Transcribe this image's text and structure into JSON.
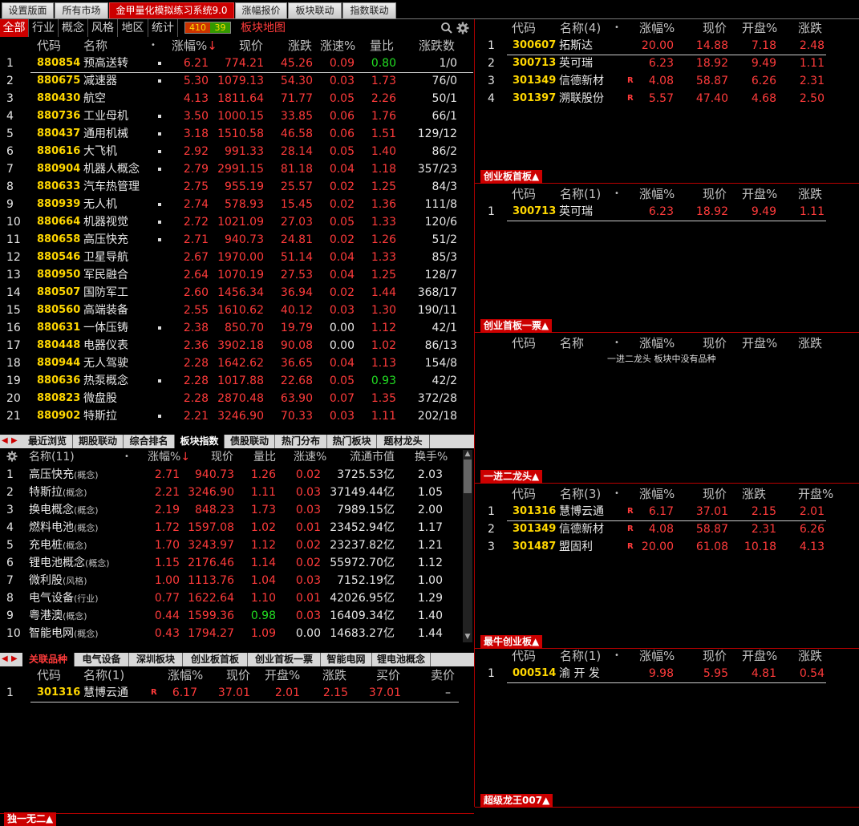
{
  "top_tabs": [
    "设置版面",
    "所有市场",
    "金甲量化模拟练习系统9.0",
    "涨幅报价",
    "板块联动",
    "指数联动"
  ],
  "cat_tabs": [
    "全部",
    "行业",
    "概念",
    "风格",
    "地区",
    "统计"
  ],
  "stat_counts": {
    "up": "410",
    "down": "39"
  },
  "map_link": "板块地图",
  "main_table": {
    "headers": [
      "代码",
      "名称",
      "涨幅%",
      "现价",
      "涨跌",
      "涨速%",
      "量比",
      "涨跌数"
    ],
    "rows": [
      [
        "1",
        "880854",
        "预高送转",
        "6.21",
        "774.21",
        "45.26",
        "0.09",
        "0.80",
        "1/0"
      ],
      [
        "2",
        "880675",
        "减速器",
        "5.30",
        "1079.13",
        "54.30",
        "0.03",
        "1.73",
        "76/0"
      ],
      [
        "3",
        "880430",
        "航空",
        "4.13",
        "1811.64",
        "71.77",
        "0.05",
        "2.26",
        "50/1"
      ],
      [
        "4",
        "880736",
        "工业母机",
        "3.50",
        "1000.15",
        "33.85",
        "0.06",
        "1.76",
        "66/1"
      ],
      [
        "5",
        "880437",
        "通用机械",
        "3.18",
        "1510.58",
        "46.58",
        "0.06",
        "1.51",
        "129/12"
      ],
      [
        "6",
        "880616",
        "大飞机",
        "2.92",
        "991.33",
        "28.14",
        "0.05",
        "1.40",
        "86/2"
      ],
      [
        "7",
        "880904",
        "机器人概念",
        "2.79",
        "2991.15",
        "81.18",
        "0.04",
        "1.18",
        "357/23"
      ],
      [
        "8",
        "880633",
        "汽车热管理",
        "2.75",
        "955.19",
        "25.57",
        "0.02",
        "1.25",
        "84/3"
      ],
      [
        "9",
        "880939",
        "无人机",
        "2.74",
        "578.93",
        "15.45",
        "0.02",
        "1.36",
        "111/8"
      ],
      [
        "10",
        "880664",
        "机器视觉",
        "2.72",
        "1021.09",
        "27.03",
        "0.05",
        "1.33",
        "120/6"
      ],
      [
        "11",
        "880658",
        "高压快充",
        "2.71",
        "940.73",
        "24.81",
        "0.02",
        "1.26",
        "51/2"
      ],
      [
        "12",
        "880546",
        "卫星导航",
        "2.67",
        "1970.00",
        "51.14",
        "0.04",
        "1.33",
        "85/3"
      ],
      [
        "13",
        "880950",
        "军民融合",
        "2.64",
        "1070.19",
        "27.53",
        "0.04",
        "1.25",
        "128/7"
      ],
      [
        "14",
        "880507",
        "国防军工",
        "2.60",
        "1456.34",
        "36.94",
        "0.02",
        "1.44",
        "368/17"
      ],
      [
        "15",
        "880560",
        "高端装备",
        "2.55",
        "1610.62",
        "40.12",
        "0.03",
        "1.30",
        "190/11"
      ],
      [
        "16",
        "880631",
        "一体压铸",
        "2.38",
        "850.70",
        "19.79",
        "0.00",
        "1.12",
        "42/1"
      ],
      [
        "17",
        "880448",
        "电器仪表",
        "2.36",
        "3902.18",
        "90.08",
        "0.00",
        "1.02",
        "86/13"
      ],
      [
        "18",
        "880944",
        "无人驾驶",
        "2.28",
        "1642.62",
        "36.65",
        "0.04",
        "1.13",
        "154/8"
      ],
      [
        "19",
        "880636",
        "热泵概念",
        "2.28",
        "1017.88",
        "22.68",
        "0.05",
        "0.93",
        "42/2"
      ],
      [
        "20",
        "880823",
        "微盘股",
        "2.28",
        "2870.48",
        "63.90",
        "0.07",
        "1.35",
        "372/28"
      ],
      [
        "21",
        "880902",
        "特斯拉",
        "2.21",
        "3246.90",
        "70.33",
        "0.03",
        "1.11",
        "202/18"
      ]
    ]
  },
  "mid_tabs": [
    "最近浏览",
    "期股联动",
    "综合排名",
    "板块指数",
    "债股联动",
    "热门分布",
    "热门板块",
    "题材龙头"
  ],
  "mid_table": {
    "headers": [
      "名称(11)",
      "涨幅%",
      "现价",
      "量比",
      "涨速%",
      "流通市值",
      "换手%"
    ],
    "rows": [
      [
        "1",
        "高压快充",
        "(概念)",
        "2.71",
        "940.73",
        "1.26",
        "0.02",
        "3725.53亿",
        "2.03"
      ],
      [
        "2",
        "特斯拉",
        "(概念)",
        "2.21",
        "3246.90",
        "1.11",
        "0.03",
        "37149.44亿",
        "1.05"
      ],
      [
        "3",
        "换电概念",
        "(概念)",
        "2.19",
        "848.23",
        "1.73",
        "0.03",
        "7989.15亿",
        "2.00"
      ],
      [
        "4",
        "燃料电池",
        "(概念)",
        "1.72",
        "1597.08",
        "1.02",
        "0.01",
        "23452.94亿",
        "1.17"
      ],
      [
        "5",
        "充电桩",
        "(概念)",
        "1.70",
        "3243.97",
        "1.12",
        "0.02",
        "23237.82亿",
        "1.21"
      ],
      [
        "6",
        "锂电池概念",
        "(概念)",
        "1.15",
        "2176.46",
        "1.14",
        "0.02",
        "55972.70亿",
        "1.12"
      ],
      [
        "7",
        "微利股",
        "(风格)",
        "1.00",
        "1113.76",
        "1.04",
        "0.03",
        "7152.19亿",
        "1.00"
      ],
      [
        "8",
        "电气设备",
        "(行业)",
        "0.77",
        "1622.64",
        "1.10",
        "0.01",
        "42026.95亿",
        "1.29"
      ],
      [
        "9",
        "粤港澳",
        "(概念)",
        "0.44",
        "1599.36",
        "0.98",
        "0.03",
        "16409.34亿",
        "1.40"
      ],
      [
        "10",
        "智能电网",
        "(概念)",
        "0.43",
        "1794.27",
        "1.09",
        "0.00",
        "14683.27亿",
        "1.44"
      ]
    ]
  },
  "bottom_tabs": [
    "关联品种",
    "电气设备",
    "深圳板块",
    "创业板首板",
    "创业首板一票",
    "智能电网",
    "锂电池概念"
  ],
  "bottom_table": {
    "headers": [
      "代码",
      "名称(1)",
      "涨幅%",
      "现价",
      "开盘%",
      "涨跌",
      "买价",
      "卖价"
    ],
    "rows": [
      [
        "1",
        "301316",
        "慧博云通",
        "R",
        "6.17",
        "37.01",
        "2.01",
        "2.15",
        "37.01",
        "–"
      ]
    ]
  },
  "left_footer": "独一无二",
  "panels": [
    {
      "headers": [
        "代码",
        "名称(4)",
        "•",
        "涨幅%",
        "现价",
        "开盘%",
        "涨跌"
      ],
      "rows": [
        [
          "1",
          "300607",
          "拓斯达",
          "",
          "20.00",
          "14.88",
          "7.18",
          "2.48"
        ],
        [
          "2",
          "300713",
          "英可瑞",
          "",
          "6.23",
          "18.92",
          "9.49",
          "1.11"
        ],
        [
          "3",
          "301349",
          "信德新材",
          "R",
          "4.08",
          "58.87",
          "6.26",
          "2.31"
        ],
        [
          "4",
          "301397",
          "溯联股份",
          "R",
          "5.57",
          "47.40",
          "4.68",
          "2.50"
        ]
      ],
      "footer": "创业板首板"
    },
    {
      "headers": [
        "代码",
        "名称(1)",
        "•",
        "涨幅%",
        "现价",
        "开盘%",
        "涨跌"
      ],
      "rows": [
        [
          "1",
          "300713",
          "英可瑞",
          "",
          "6.23",
          "18.92",
          "9.49",
          "1.11"
        ]
      ],
      "footer": "创业首板一票"
    },
    {
      "headers": [
        "代码",
        "名称",
        "•",
        "涨幅%",
        "现价",
        "开盘%",
        "涨跌"
      ],
      "rows": [],
      "empty_msg": "一进二龙头 板块中没有品种",
      "footer": "一进二龙头"
    },
    {
      "headers": [
        "代码",
        "名称(3)",
        "•",
        "涨幅%",
        "现价",
        "涨跌",
        "开盘%"
      ],
      "rows": [
        [
          "1",
          "301316",
          "慧博云通",
          "R",
          "6.17",
          "37.01",
          "2.15",
          "2.01"
        ],
        [
          "2",
          "301349",
          "信德新材",
          "R",
          "4.08",
          "58.87",
          "2.31",
          "6.26"
        ],
        [
          "3",
          "301487",
          "盟固利",
          "R",
          "20.00",
          "61.08",
          "10.18",
          "4.13"
        ]
      ],
      "footer": "最牛创业板"
    },
    {
      "headers": [
        "代码",
        "名称(1)",
        "•",
        "涨幅%",
        "现价",
        "开盘%",
        "涨跌"
      ],
      "rows": [
        [
          "1",
          "000514",
          "渝 开 发",
          "",
          "9.98",
          "5.95",
          "4.81",
          "0.54"
        ]
      ],
      "footer": "超级龙王007"
    }
  ],
  "icons": {
    "search": "search-icon",
    "settings": "gear-icon",
    "sort_desc": "arrow-down-icon",
    "tab_up": "triangle-up-icon"
  },
  "colors": {
    "up": "#ff3b3b",
    "down": "#22dd22",
    "code": "#ffd700",
    "active_tab": "#cc0000"
  }
}
